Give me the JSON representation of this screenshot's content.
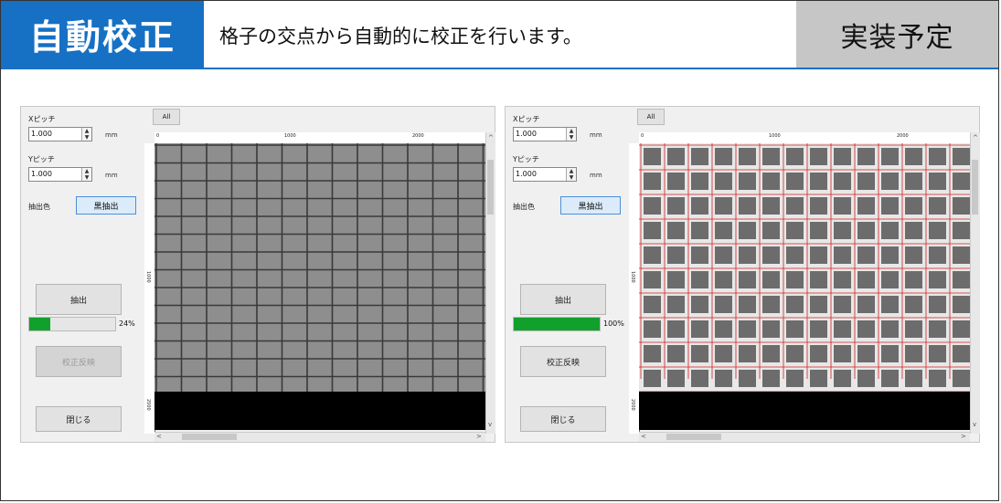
{
  "header": {
    "title": "自動校正",
    "subtitle": "格子の交点から自動的に校正を行います。",
    "status": "実装予定"
  },
  "colors": {
    "accent": "#1670c4",
    "progress": "#12a02c",
    "badge": "#c6c6c6"
  },
  "left_panel": {
    "x_pitch_label": "Xピッチ",
    "x_pitch_value": "1.000",
    "y_pitch_label": "Yピッチ",
    "y_pitch_value": "1.000",
    "unit": "mm",
    "color_label": "抽出色",
    "color_button": "黒抽出",
    "extract_button": "抽出",
    "progress_text": "24%",
    "progress_fraction": 0.24,
    "apply_button": "校正反映",
    "apply_disabled": true,
    "close_button": "閉じる",
    "all_button": "All",
    "ruler_h": [
      "0",
      "1000",
      "2000"
    ],
    "ruler_v": [
      "1000",
      "2000"
    ]
  },
  "right_panel": {
    "x_pitch_label": "Xピッチ",
    "x_pitch_value": "1.000",
    "y_pitch_label": "Yピッチ",
    "y_pitch_value": "1.000",
    "unit": "mm",
    "color_label": "抽出色",
    "color_button": "黒抽出",
    "extract_button": "抽出",
    "progress_text": "100%",
    "progress_fraction": 1.0,
    "apply_button": "校正反映",
    "apply_disabled": false,
    "close_button": "閉じる",
    "all_button": "All",
    "ruler_h": [
      "0",
      "1000",
      "2000"
    ],
    "ruler_v": [
      "1000",
      "2000"
    ]
  }
}
